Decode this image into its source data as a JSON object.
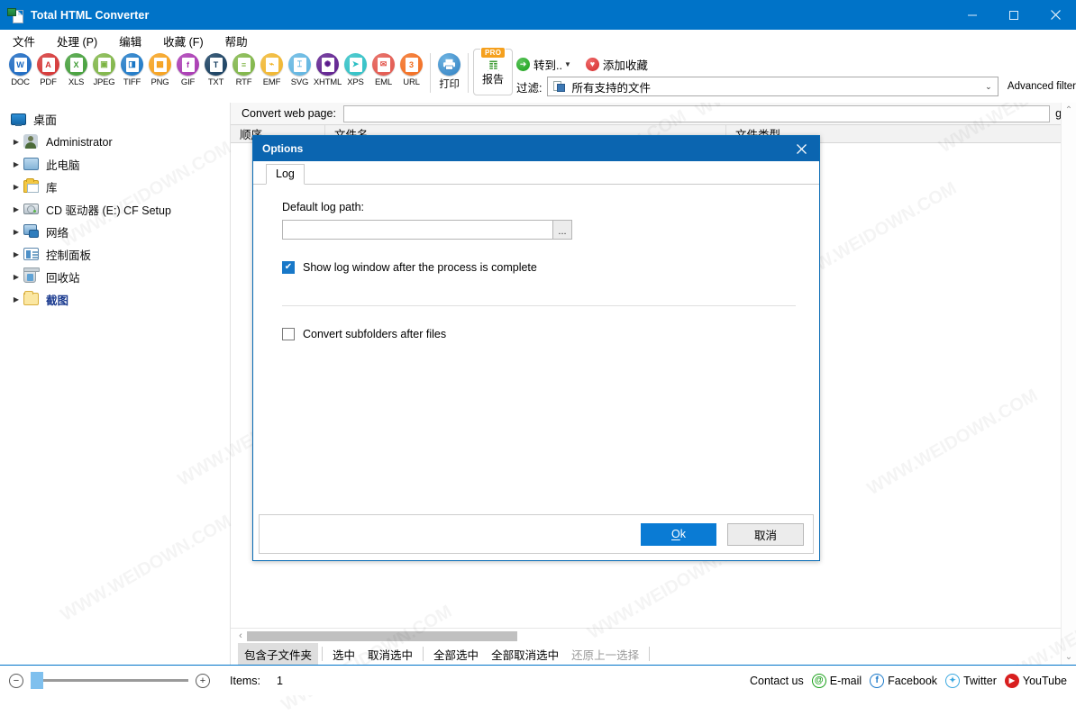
{
  "window": {
    "title": "Total HTML Converter",
    "app_icon": "html-converter-icon",
    "minimize": "–",
    "maximize": "□",
    "close": "✕"
  },
  "menu": {
    "items": [
      {
        "label": "文件",
        "name": "menu-file"
      },
      {
        "label": "处理 (P)",
        "name": "menu-process"
      },
      {
        "label": "编辑",
        "name": "menu-edit"
      },
      {
        "label": "收藏 (F)",
        "name": "menu-favorites"
      },
      {
        "label": "帮助",
        "name": "menu-help"
      }
    ]
  },
  "toolbar": {
    "formats": [
      {
        "label": "DOC",
        "glyph": "W",
        "color": "#1565c0",
        "name": "convert-to-doc"
      },
      {
        "label": "PDF",
        "glyph": "A",
        "color": "#d32f2f",
        "name": "convert-to-pdf"
      },
      {
        "label": "XLS",
        "glyph": "X",
        "color": "#3f9c35",
        "name": "convert-to-xls"
      },
      {
        "label": "JPEG",
        "glyph": "▣",
        "color": "#7cb342",
        "name": "convert-to-jpeg"
      },
      {
        "label": "TIFF",
        "glyph": "◨",
        "color": "#1976c5",
        "name": "convert-to-tiff"
      },
      {
        "label": "PNG",
        "glyph": "▩",
        "color": "#f59e16",
        "name": "convert-to-png"
      },
      {
        "label": "GIF",
        "glyph": "f",
        "color": "#a633b0",
        "name": "convert-to-gif"
      },
      {
        "label": "TXT",
        "glyph": "T",
        "color": "#123a5c",
        "name": "convert-to-txt"
      },
      {
        "label": "RTF",
        "glyph": "≡",
        "color": "#7cb342",
        "name": "convert-to-rtf"
      },
      {
        "label": "EMF",
        "glyph": "⌁",
        "color": "#f0b429",
        "name": "convert-to-emf"
      },
      {
        "label": "SVG",
        "glyph": "⌶",
        "color": "#5cb3e0",
        "name": "convert-to-svg"
      },
      {
        "label": "XHTML",
        "glyph": "✺",
        "color": "#5b1a8c",
        "name": "convert-to-xhtml"
      },
      {
        "label": "XPS",
        "glyph": "➤",
        "color": "#2bbfc4",
        "name": "convert-to-xps"
      },
      {
        "label": "EML",
        "glyph": "✉",
        "color": "#e2544a",
        "name": "convert-to-eml"
      },
      {
        "label": "URL",
        "glyph": "3",
        "color": "#f26a1b",
        "name": "convert-to-url"
      }
    ],
    "print": {
      "label": "打印",
      "color": "#2f7fc1",
      "name": "print-button"
    },
    "report": {
      "label": "报告",
      "badge": "PRO",
      "color": "#1f9d3e",
      "name": "report-button"
    },
    "goto": {
      "label": "转到..",
      "name": "goto-button"
    },
    "add_favorite": {
      "label": "添加收藏",
      "name": "add-favorite-button"
    },
    "filter_label": "过滤:",
    "filter_value": "所有支持的文件",
    "advanced_filter": "Advanced filter"
  },
  "sidebar": {
    "items": [
      {
        "label": "桌面",
        "icon": "desktop-icon",
        "expandable": false,
        "selected": false,
        "name": "tree-item-desktop"
      },
      {
        "label": "Administrator",
        "icon": "user-icon",
        "expandable": true,
        "selected": false,
        "name": "tree-item-administrator"
      },
      {
        "label": "此电脑",
        "icon": "this-pc-icon",
        "expandable": true,
        "selected": false,
        "name": "tree-item-this-pc"
      },
      {
        "label": "库",
        "icon": "library-icon",
        "expandable": true,
        "selected": false,
        "name": "tree-item-library"
      },
      {
        "label": "CD 驱动器 (E:) CF Setup",
        "icon": "cd-drive-icon",
        "expandable": true,
        "selected": false,
        "name": "tree-item-cd-drive"
      },
      {
        "label": "网络",
        "icon": "network-icon",
        "expandable": true,
        "selected": false,
        "name": "tree-item-network"
      },
      {
        "label": "控制面板",
        "icon": "control-panel-icon",
        "expandable": true,
        "selected": false,
        "name": "tree-item-control-panel"
      },
      {
        "label": "回收站",
        "icon": "recycle-bin-icon",
        "expandable": true,
        "selected": false,
        "name": "tree-item-recycle-bin"
      },
      {
        "label": "截图",
        "icon": "folder-icon",
        "expandable": true,
        "selected": true,
        "name": "tree-item-screenshots"
      }
    ]
  },
  "filelist": {
    "web_page_label": "Convert web page:",
    "web_page_value": "",
    "go_label": "go",
    "columns": [
      "顺序",
      "文件名",
      "文件类型"
    ],
    "rows": []
  },
  "selection_bar": {
    "include_subfolders": "包含子文件夹",
    "select": "选中",
    "deselect": "取消选中",
    "select_all": "全部选中",
    "deselect_all": "全部取消选中",
    "restore_previous": "还原上一选择"
  },
  "statusbar": {
    "zoom_out": "−",
    "zoom_in": "+",
    "items_label": "Items:",
    "items_count": "1",
    "contact_us": "Contact us",
    "social": [
      {
        "label": "E-mail",
        "glyph": "@",
        "color": "#18a018",
        "name": "email-link"
      },
      {
        "label": "Facebook",
        "glyph": "f",
        "color": "#1877c9",
        "name": "facebook-link"
      },
      {
        "label": "Twitter",
        "glyph": "🐦",
        "color": "#3aa8e0",
        "name": "twitter-link"
      },
      {
        "label": "YouTube",
        "glyph": "▶",
        "color": "#d81f1f",
        "name": "youtube-link"
      }
    ]
  },
  "dialog": {
    "title": "Options",
    "close": "✕",
    "tabs": [
      {
        "label": "Log",
        "active": true,
        "name": "dialog-tab-log"
      }
    ],
    "log_path_label": "Default log path:",
    "log_path_value": "",
    "browse_label": "...",
    "show_log_checkbox": {
      "label": "Show log window after the process is complete",
      "checked": true
    },
    "convert_subfolders_checkbox": {
      "label": "Convert subfolders after files",
      "checked": false
    },
    "ok_label": "Ok",
    "cancel_label": "取消"
  },
  "watermarks": [
    "WWW.WEIDOWN.COM",
    "WWW.WEIDOWN.COM",
    "WWW.WEIDOWN.COM",
    "WWW.WEIDOWN.COM",
    "WWW.WEIDOWN.COM",
    "WWW.WEIDOWN.COM",
    "WWW.WEIDOWN.COM",
    "WWW.WEIDOWN.COM",
    "WWW.WEIDOWN.COM"
  ]
}
